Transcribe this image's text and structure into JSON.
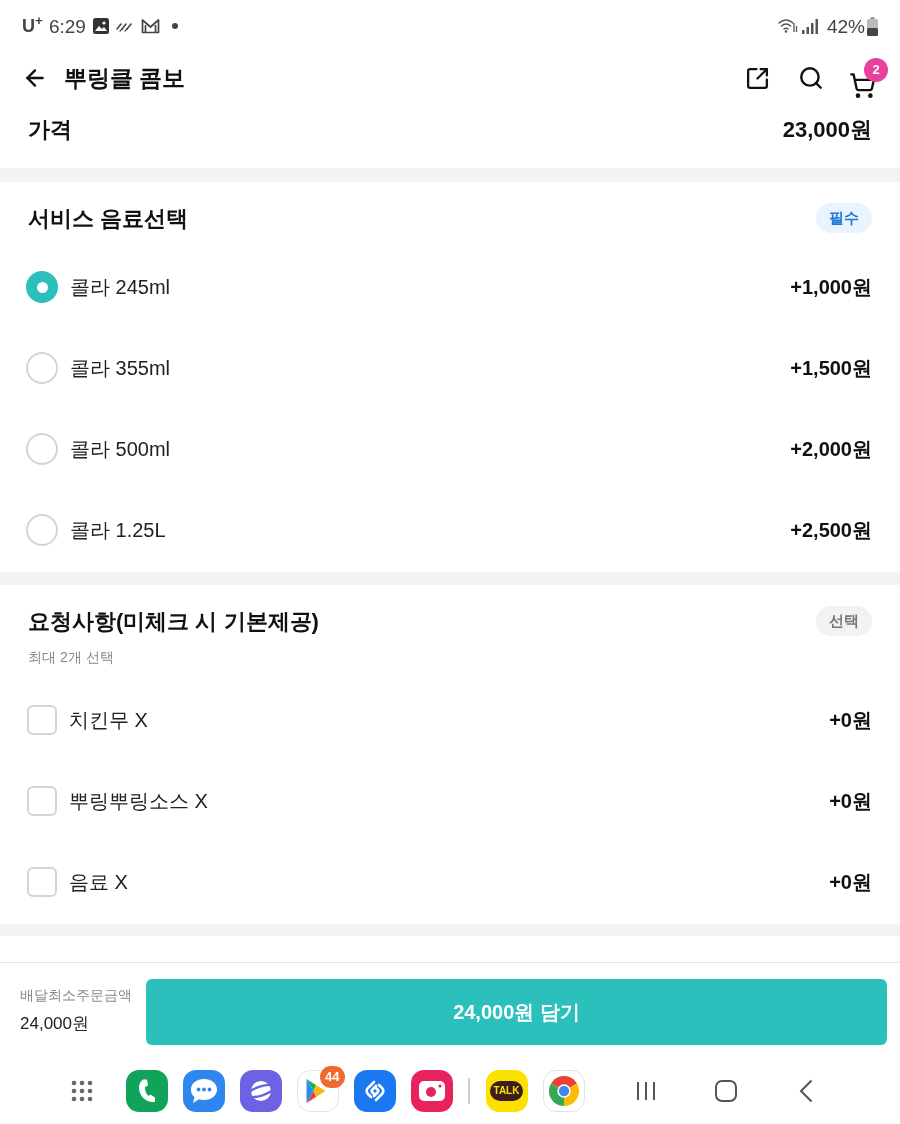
{
  "status_bar": {
    "carrier": "U$^{+}$",
    "time": "6:29",
    "battery": "42%"
  },
  "header": {
    "title": "뿌링클 콤보",
    "cart_count": "2"
  },
  "price": {
    "label": "가격",
    "value": "23,000원"
  },
  "option_groups": [
    {
      "kind": "radio",
      "title": "서비스 음료선택",
      "badge": {
        "kind": "required",
        "text": "필수"
      },
      "options": [
        {
          "label": "콜라 245ml",
          "price": "+1,000원",
          "selected": true
        },
        {
          "label": "콜라 355ml",
          "price": "+1,500원",
          "selected": false
        },
        {
          "label": "콜라 500ml",
          "price": "+2,000원",
          "selected": false
        },
        {
          "label": "콜라 1.25L",
          "price": "+2,500원",
          "selected": false
        }
      ]
    },
    {
      "kind": "checkbox",
      "title": "요청사항(미체크 시 기본제공)",
      "subtitle": "최대 2개 선택",
      "badge": {
        "kind": "optional",
        "text": "선택"
      },
      "options": [
        {
          "label": "치킨무 X",
          "price": "+0원",
          "checked": false
        },
        {
          "label": "뿌링뿌링소스 X",
          "price": "+0원",
          "checked": false
        },
        {
          "label": "음료 X",
          "price": "+0원",
          "checked": false
        }
      ]
    }
  ],
  "footer": {
    "min_order_label": "배달최소주문금액",
    "min_order_value": "24,000원",
    "add_button": "24,000원 담기"
  },
  "dock": [
    {
      "kind": "apps"
    },
    {
      "kind": "phone"
    },
    {
      "kind": "messages"
    },
    {
      "kind": "browser"
    },
    {
      "kind": "store",
      "badge": "44"
    },
    {
      "kind": "music"
    },
    {
      "kind": "camera"
    },
    {
      "kind": "divider"
    },
    {
      "kind": "chat",
      "label": "TALK"
    },
    {
      "kind": "chrome"
    },
    {
      "kind": "recents"
    },
    {
      "kind": "home"
    },
    {
      "kind": "back"
    }
  ]
}
